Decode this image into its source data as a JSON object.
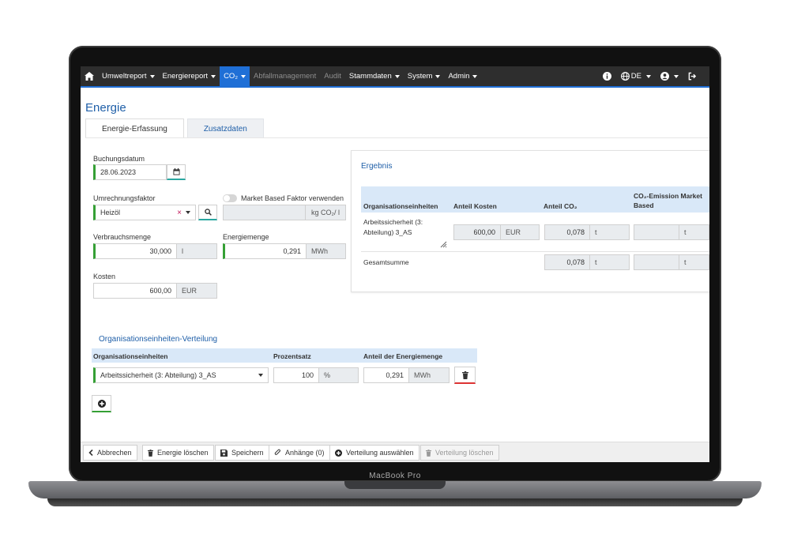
{
  "nav": {
    "items": [
      {
        "label": "Umweltreport",
        "dropdown": true,
        "active": false,
        "disabled": false
      },
      {
        "label": "Energiereport",
        "dropdown": true,
        "active": false,
        "disabled": false
      },
      {
        "label": "CO₂",
        "dropdown": true,
        "active": true,
        "disabled": false
      },
      {
        "label": "Abfallmanagement",
        "dropdown": false,
        "active": false,
        "disabled": true
      },
      {
        "label": "Audit",
        "dropdown": false,
        "active": false,
        "disabled": true
      },
      {
        "label": "Stammdaten",
        "dropdown": true,
        "active": false,
        "disabled": false
      },
      {
        "label": "System",
        "dropdown": true,
        "active": false,
        "disabled": false
      },
      {
        "label": "Admin",
        "dropdown": true,
        "active": false,
        "disabled": false
      }
    ],
    "language": "DE",
    "accent_color": "#1f6fd6"
  },
  "page": {
    "title": "Energie",
    "tabs": [
      "Energie-Erfassung",
      "Zusatzdaten"
    ]
  },
  "form": {
    "buchungsdatum_label": "Buchungsdatum",
    "buchungsdatum_value": "28.06.2023",
    "umrechnungsfaktor_label": "Umrechnungsfaktor",
    "umrechnungsfaktor_value": "Heizöl",
    "market_based_label": "Market Based Faktor verwenden",
    "factor_unit": "kg CO₂/ l",
    "verbrauchsmenge_label": "Verbrauchsmenge",
    "verbrauchsmenge_value": "30,000",
    "verbrauchsmenge_unit": "l",
    "energiemenge_label": "Energiemenge",
    "energiemenge_value": "0,291",
    "energiemenge_unit": "MWh",
    "kosten_label": "Kosten",
    "kosten_value": "600,00",
    "kosten_unit": "EUR"
  },
  "ergebnis": {
    "title": "Ergebnis",
    "headers": [
      "Organisationseinheiten",
      "Anteil Kosten",
      "Anteil CO₂",
      "CO₂-Emission Market Based"
    ],
    "row": {
      "org": "Arbeitssicherheit (3: Abteilung) 3_AS",
      "kosten": "600,00",
      "kosten_unit": "EUR",
      "co2": "0,078",
      "co2_unit": "t",
      "market_unit": "t"
    },
    "total": {
      "label": "Gesamtsumme",
      "co2": "0,078",
      "co2_unit": "t",
      "market_unit": "t"
    }
  },
  "verteilung": {
    "title": "Organisationseinheiten-Verteilung",
    "headers": [
      "Organisationseinheiten",
      "Prozentsatz",
      "Anteil der Energiemenge"
    ],
    "row": {
      "org": "Arbeitssicherheit (3: Abteilung) 3_AS",
      "prozent": "100",
      "prozent_unit": "%",
      "energie": "0,291",
      "energie_unit": "MWh"
    }
  },
  "toolbar": {
    "abbrechen": "Abbrechen",
    "energie_loeschen": "Energie löschen",
    "speichern": "Speichern",
    "anhaenge": "Anhänge (0)",
    "verteilung_auswaehlen": "Verteilung auswählen",
    "verteilung_loeschen": "Verteilung löschen"
  },
  "device": {
    "brand": "MacBook Pro"
  }
}
